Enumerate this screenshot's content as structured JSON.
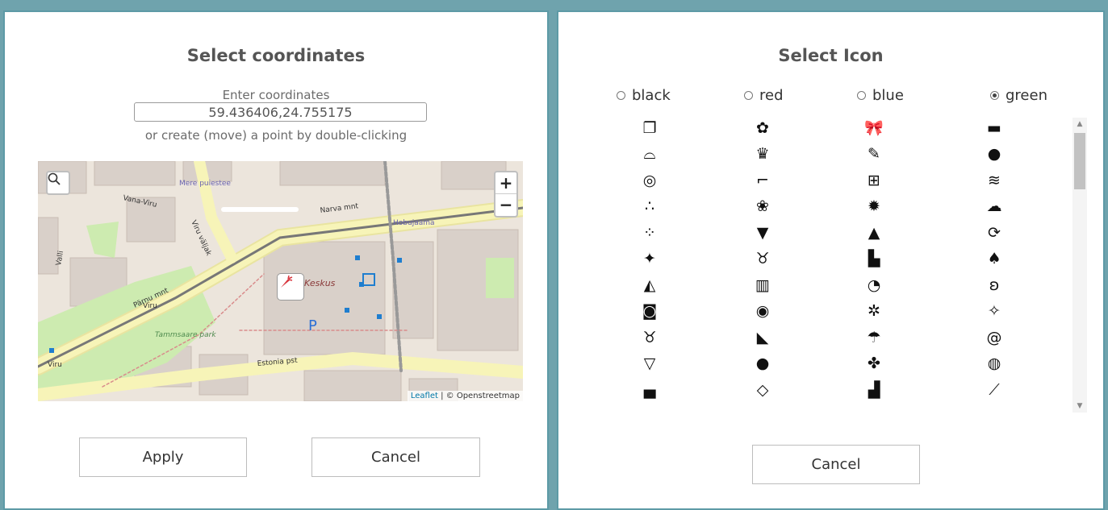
{
  "coordinates_dialog": {
    "title": "Select coordinates",
    "coord_label": "Enter coordinates",
    "coord_value": "59.436406,24.755175",
    "hint": "or create (move) a point by double-clicking",
    "map": {
      "zoom_in": "+",
      "zoom_out": "−",
      "attribution_leaflet": "Leaflet",
      "attribution_osm": "| © Openstreetmap",
      "labels": {
        "mere_puiestee": "Mere puiestee",
        "vana_viru": "Vana-Viru",
        "narva_mnt": "Narva mnt",
        "hobujaama": "Hobujaama",
        "parnu_mnt": "Pärnu mnt",
        "viru_valjak": "Viru väljak",
        "tammsaare_park": "Tammsaare park",
        "keskus": "Keskus",
        "estonia_pst": "Estonia pst",
        "viru": "Viru",
        "valli": "Valli",
        "viru2": "Viru",
        "p": "P"
      },
      "marker_icon": "carrot-icon"
    },
    "apply_label": "Apply",
    "cancel_label": "Cancel"
  },
  "icon_dialog": {
    "title": "Select Icon",
    "colors": [
      {
        "label": "black",
        "selected": false
      },
      {
        "label": "red",
        "selected": false
      },
      {
        "label": "blue",
        "selected": false
      },
      {
        "label": "green",
        "selected": true
      }
    ],
    "icons": [
      [
        "bread-icon",
        "flower-icon",
        "bow-icon",
        "monitor-icon"
      ],
      [
        "shoe-icon",
        "cake-basket-icon",
        "candy-icon",
        "strawberry-icon"
      ],
      [
        "donut-icon",
        "high-heel-icon",
        "first-aid-icon",
        "wind-icon"
      ],
      [
        "drops-icon",
        "cloud-icon",
        "sun-icon",
        "storm-icon"
      ],
      [
        "snowflakes-icon",
        "tornado-icon",
        "mountain-icon",
        "recycle-icon"
      ],
      [
        "bat-icon",
        "deer-icon",
        "cake-icon",
        "mushroom-icon"
      ],
      [
        "cheese-icon",
        "cup-icon",
        "apple-icon",
        "butterfly-icon"
      ],
      [
        "monkey-icon",
        "mask-icon",
        "ant-icon",
        "fairy-icon"
      ],
      [
        "cow-icon",
        "shark-icon",
        "umbrella-icon",
        "snail-icon"
      ],
      [
        "fox-icon",
        "bear-icon",
        "clover-icon",
        "owl-icon"
      ],
      [
        "graduate-icon",
        "bottle-icon",
        "toilet-icon",
        "comb-icon"
      ]
    ],
    "glyphs": [
      [
        "❐",
        "✿",
        "🎀",
        "▬"
      ],
      [
        "⌓",
        "♛",
        "✎",
        "●"
      ],
      [
        "◎",
        "⌐",
        "⊞",
        "≋"
      ],
      [
        "∴",
        "❀",
        "✹",
        "☁"
      ],
      [
        "⁘",
        "▼",
        "▲",
        "⟳"
      ],
      [
        "✦",
        "♉",
        "▙",
        "♠"
      ],
      [
        "◭",
        "▥",
        "◔",
        "ʚ"
      ],
      [
        "◙",
        "◉",
        "✲",
        "✧"
      ],
      [
        "♉",
        "◣",
        "☂",
        "@"
      ],
      [
        "▽",
        "●",
        "✤",
        "◍"
      ],
      [
        "▄",
        "◇",
        "▟",
        "⟋"
      ]
    ],
    "cancel_label": "Cancel"
  },
  "colors": {
    "frame": "#5d9aa6",
    "road_yellow": "#f7f4b8",
    "building": "#d9d0c9",
    "park_green": "#cdebb0",
    "marker_red": "#d9363e"
  }
}
